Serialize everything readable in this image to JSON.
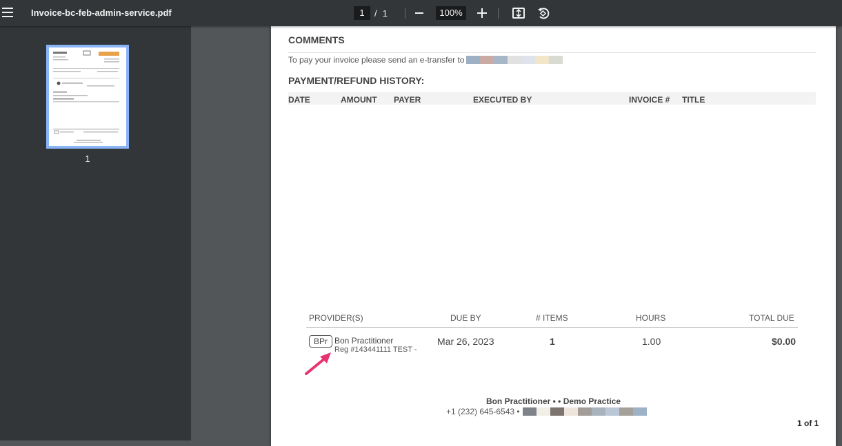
{
  "toolbar": {
    "title": "Invoice-bc-feb-admin-service.pdf",
    "current_page": "1",
    "page_separator": "/",
    "total_pages": "1",
    "zoom": "100%"
  },
  "sidebar": {
    "thumbnail_label": "1"
  },
  "document": {
    "comments_heading": "COMMENTS",
    "etransfer_text": "To pay your invoice please send an e-transfer to",
    "payment_heading": "PAYMENT/REFUND HISTORY:",
    "payment_columns": [
      "DATE",
      "AMOUNT",
      "PAYER",
      "EXECUTED BY",
      "INVOICE #",
      "TITLE"
    ],
    "provider_columns": [
      "PROVIDER(S)",
      "DUE BY",
      "# ITEMS",
      "HOURS",
      "TOTAL DUE"
    ],
    "provider": {
      "badge": "BPr",
      "name": "Bon Practitioner",
      "reg": "Reg #143441111 TEST -",
      "due_by": "Mar 26, 2023",
      "items": "1",
      "hours": "1.00",
      "total_due": "$0.00"
    },
    "footer_name": "Bon Practitioner •  • Demo Practice",
    "footer_phone": "+1 (232) 645-6543 •",
    "page_of": "1 of 1"
  },
  "colors": {
    "toolbar_bg": "#323639",
    "viewer_bg": "#525659",
    "thumb_border": "#8ab4f8",
    "annotation_arrow": "#e8336f"
  },
  "icons": [
    "menu-icon",
    "zoom-out-icon",
    "zoom-in-icon",
    "fit-to-page-icon",
    "rotate-icon",
    "annotation-arrow"
  ]
}
